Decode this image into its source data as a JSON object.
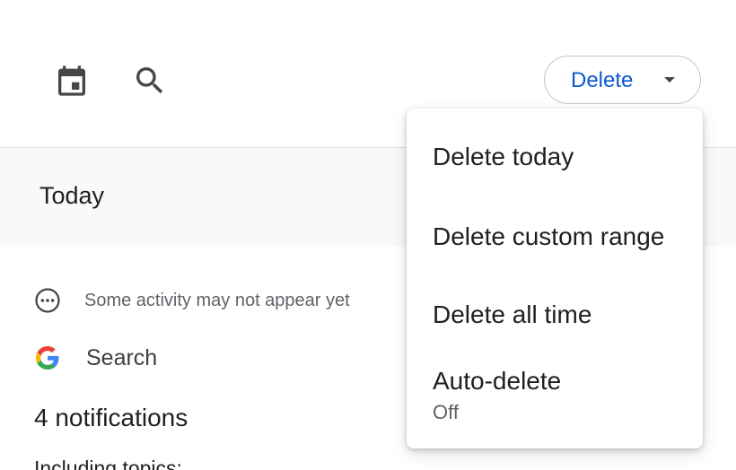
{
  "toolbar": {
    "calendar_icon": "calendar-icon",
    "search_icon": "search-icon",
    "delete_label": "Delete"
  },
  "section": {
    "title": "Today"
  },
  "notice": {
    "icon": "more-horizontal-circle-icon",
    "text": "Some activity may not appear yet"
  },
  "activity": {
    "product_icon": "google-g-icon",
    "product_name": "Search",
    "notifications": "4 notifications",
    "topics_label": "Including topics:"
  },
  "delete_menu": {
    "items": [
      {
        "label": "Delete today"
      },
      {
        "label": "Delete custom range"
      },
      {
        "label": "Delete all time"
      },
      {
        "label": "Auto-delete",
        "sublabel": "Off"
      }
    ]
  },
  "colors": {
    "accent": "#0b57d0",
    "text_primary": "#1f1f1f",
    "text_secondary": "#5f6368",
    "band": "#f8f9fa",
    "divider": "#dadce0",
    "google_blue": "#4285F4",
    "google_red": "#EA4335",
    "google_yellow": "#FBBC05",
    "google_green": "#34A853"
  }
}
